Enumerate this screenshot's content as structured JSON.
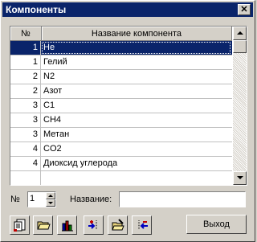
{
  "window": {
    "title": "Компоненты",
    "close_glyph": "✕"
  },
  "table": {
    "headers": {
      "num": "№",
      "name": "Название компонента"
    },
    "rows": [
      {
        "num": "1",
        "name": "He",
        "selected": true
      },
      {
        "num": "1",
        "name": "Гелий"
      },
      {
        "num": "2",
        "name": "N2"
      },
      {
        "num": "2",
        "name": "Азот"
      },
      {
        "num": "3",
        "name": "C1"
      },
      {
        "num": "3",
        "name": "CH4"
      },
      {
        "num": "3",
        "name": "Метан"
      },
      {
        "num": "4",
        "name": "CO2"
      },
      {
        "num": "4",
        "name": "Диоксид углерода"
      },
      {
        "num": "",
        "name": ""
      }
    ]
  },
  "form": {
    "num_label": "№",
    "num_value": "1",
    "name_label": "Название:",
    "name_value": ""
  },
  "toolbar": {
    "buttons": [
      {
        "name": "new-record-button",
        "icon": "document-icon"
      },
      {
        "name": "open-button",
        "icon": "folder-icon"
      },
      {
        "name": "chart-button",
        "icon": "bar-chart-icon"
      },
      {
        "name": "add-component-button",
        "icon": "add-arrow-icon"
      },
      {
        "name": "edit-button",
        "icon": "edit-folder-icon"
      },
      {
        "name": "remove-component-button",
        "icon": "remove-arrow-icon"
      }
    ],
    "exit_label": "Выход"
  },
  "colors": {
    "selection": "#0a246a",
    "face": "#d4d0c8",
    "title_bg": "#0a246a"
  }
}
